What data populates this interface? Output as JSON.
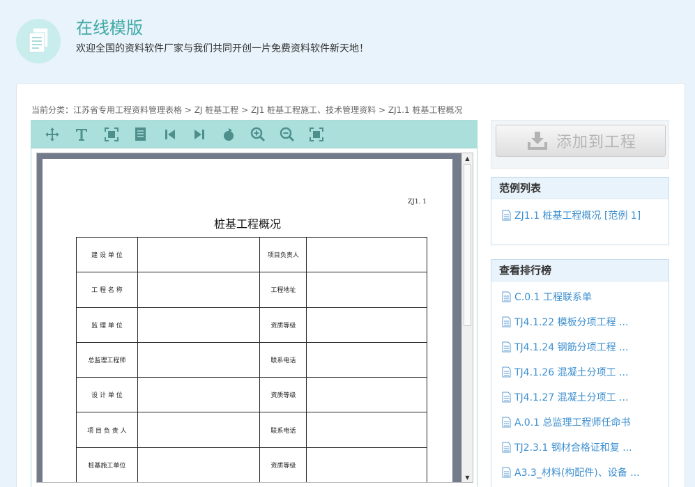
{
  "header": {
    "title": "在线模版",
    "subtitle": "欢迎全国的资料软件厂家与我们共同开创一片免费资料软件新天地！"
  },
  "breadcrumb": {
    "prefix": "当前分类：",
    "path": "江苏省专用工程资料管理表格 > ZJ 桩基工程 > ZJ1 桩基工程施工、技术管理资料 > ZJ1.1 桩基工程概况"
  },
  "toolbar": {
    "icons": [
      "move-icon",
      "text-icon",
      "fit-width-icon",
      "page-icon",
      "first-page-icon",
      "last-page-icon",
      "rotate-icon",
      "zoom-in-icon",
      "zoom-out-icon",
      "fit-page-icon"
    ]
  },
  "document": {
    "code": "ZJ1. 1",
    "title": "桩基工程概况",
    "rows": [
      {
        "label1": "建 设 单 位",
        "label2": "项目负责人"
      },
      {
        "label1": "工 程 名 称",
        "label2": "工程地址"
      },
      {
        "label1": "监 理 单 位",
        "label2": "资质等级"
      },
      {
        "label1": "总监理工程师",
        "label2": "联系电话"
      },
      {
        "label1": "设 计 单 位",
        "label2": "资质等级"
      },
      {
        "label1": "项 目 负 责 人",
        "label2": "联系电话"
      },
      {
        "label1": "桩基施工单位",
        "label2": "资质等级"
      }
    ]
  },
  "add_button": {
    "label": "添加到工程"
  },
  "examples": {
    "heading": "范例列表",
    "items": [
      "ZJ1.1 桩基工程概况 [范例 1]"
    ]
  },
  "ranking": {
    "heading": "查看排行榜",
    "items": [
      "C.0.1 工程联系单",
      "TJ4.1.22 模板分项工程 ...",
      "TJ4.1.24 钢筋分项工程 ...",
      "TJ4.1.26 混凝土分项工 ...",
      "TJ4.1.27 混凝土分项工 ...",
      "A.0.1 总监理工程师任命书",
      "TJ2.3.1 钢材合格证和复 ...",
      "A3.3_材料(构配件)、设备 ..."
    ]
  },
  "colors": {
    "accent": "#3fa9a4",
    "link": "#3c8fd0",
    "toolbar": "#aadfdc",
    "header_bg": "#e9f3fb"
  }
}
